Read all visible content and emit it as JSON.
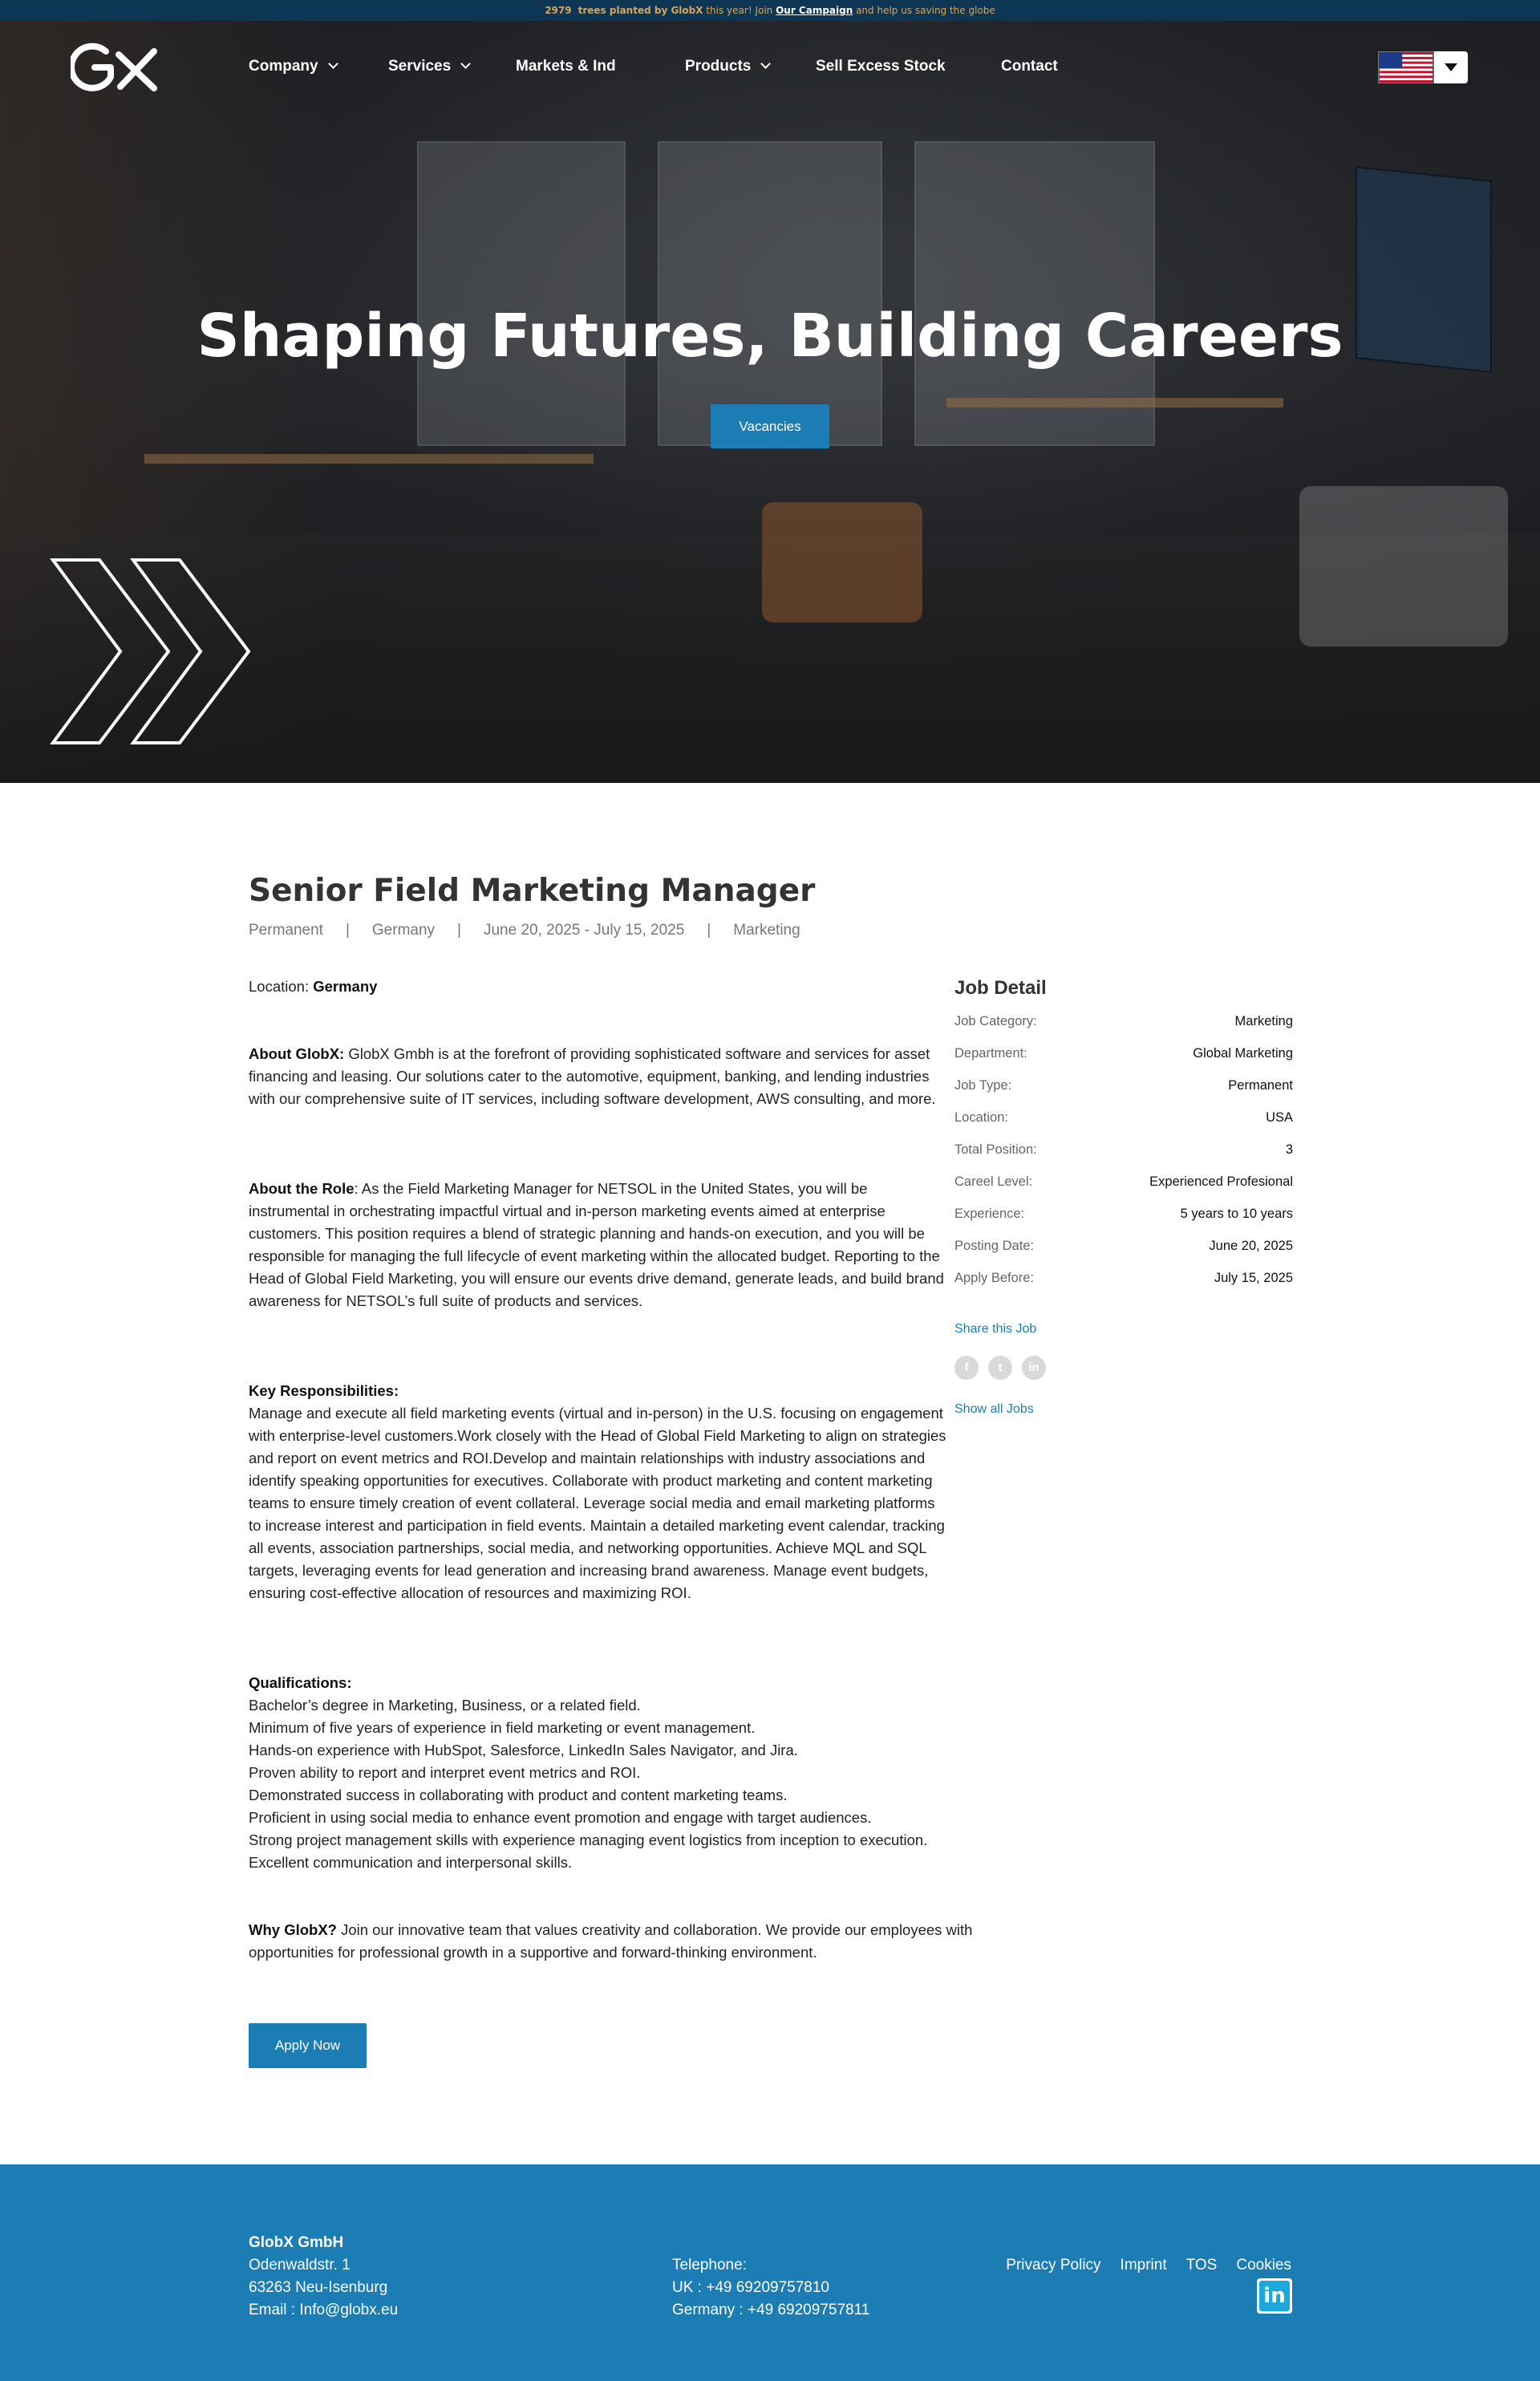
{
  "topbar": {
    "trees_count": "2979",
    "trees_text": "trees planted by GlobX",
    "middle_text": " this year! Join ",
    "campaign_link": "Our Campaign",
    "end_text": " and help us saving the globe"
  },
  "brand": {
    "logo_text": "GX"
  },
  "nav": {
    "items": [
      {
        "label": "Company",
        "has_dropdown": true
      },
      {
        "label": "Services",
        "has_dropdown": true
      },
      {
        "label": "Markets & Ind",
        "has_dropdown": false
      },
      {
        "label": "Products",
        "has_dropdown": true
      },
      {
        "label": "Sell Excess Stock",
        "has_dropdown": false
      },
      {
        "label": "Contact",
        "has_dropdown": false
      }
    ],
    "language_icon": "us-flag-icon"
  },
  "hero": {
    "title": "Shaping Futures, Building Careers",
    "cta": "Vacancies"
  },
  "job": {
    "title": "Senior Field Marketing Manager",
    "meta": [
      "Permanent",
      "Germany",
      "June 20, 2025 - July 15, 2025",
      "Marketing"
    ],
    "meta_separator": "|",
    "location_label": "Location: ",
    "location_value": "Germany",
    "about_globx_label": "About GlobX:",
    "about_globx_text": " GlobX Gmbh is at the forefront of providing sophisticated software and services for asset financing and leasing. Our solutions cater to the automotive, equipment, banking, and lending industries with our comprehensive suite of IT services, including software development, AWS consulting, and more.",
    "about_role_label": "About the Role",
    "about_role_text": ": As the Field Marketing Manager for NETSOL in the United States, you will be instrumental in orchestrating impactful virtual and in-person marketing events aimed at enterprise customers. This position requires a blend of strategic planning and hands-on execution, and you will be responsible for managing the full lifecycle of event marketing within the allocated budget. Reporting to the Head of Global Field Marketing, you will ensure our events drive demand, generate leads, and build brand awareness for NETSOL’s full suite of products and services.",
    "responsibilities_label": "Key Responsibilities:",
    "responsibilities_text": "Manage and execute all field marketing events (virtual and in-person) in the U.S. focusing on engagement with enterprise-level customers.Work closely with the Head of Global Field Marketing to align on strategies and report on event metrics and ROI.Develop and maintain relationships with industry associations and identify speaking opportunities for executives. Collaborate with product marketing and content marketing teams to ensure timely creation of event collateral. Leverage social media and email marketing platforms to increase interest and participation in field events. Maintain a detailed marketing event calendar, tracking all events, association partnerships, social media, and networking opportunities. Achieve MQL and SQL targets, leveraging events for lead generation and increasing brand awareness. Manage event budgets, ensuring cost-effective allocation of resources and maximizing ROI.",
    "qualifications_label": "Qualifications:",
    "qualifications": [
      "Bachelor’s degree in Marketing, Business, or a related field.",
      "Minimum of five years of experience in field marketing or event management.",
      "Hands-on experience with HubSpot, Salesforce, LinkedIn Sales Navigator, and Jira.",
      "Proven ability to report and interpret event metrics and ROI.",
      "Demonstrated success in collaborating with product and content marketing teams.",
      "Proficient in using social media to enhance event promotion and engage with target audiences.",
      "Strong project management skills with experience managing event logistics from inception to execution.",
      "Excellent communication and interpersonal skills."
    ],
    "why_label": "Why GlobX?",
    "why_text": " Join our innovative team that values creativity and collaboration. We provide our employees with opportunities for professional growth in a supportive and forward-thinking environment.",
    "apply_label": "Apply Now"
  },
  "sidebar": {
    "title": "Job Detail",
    "details": [
      {
        "key": "Job Category:",
        "value": "Marketing"
      },
      {
        "key": "Department:",
        "value": "Global Marketing"
      },
      {
        "key": "Job Type:",
        "value": "Permanent"
      },
      {
        "key": "Location:",
        "value": "USA"
      },
      {
        "key": "Total Position:",
        "value": "3"
      },
      {
        "key": "Careel Level:",
        "value": "Experienced Profesional"
      },
      {
        "key": "Experience:",
        "value": "5 years to 10 years"
      },
      {
        "key": "Posting Date:",
        "value": "June 20, 2025"
      },
      {
        "key": "Apply Before:",
        "value": "July 15, 2025"
      }
    ],
    "share_title": "Share this Job",
    "share_icons": [
      "facebook-icon",
      "twitter-icon",
      "linkedin-icon"
    ],
    "show_all": "Show all Jobs"
  },
  "footer": {
    "company": "GlobX GmbH",
    "street": "Odenwaldstr. 1",
    "city": "63263 Neu-Isenburg",
    "email": "Email : Info@globx.eu",
    "telephone_label": "Telephone:",
    "phone_uk": "UK : +49 69209757810",
    "phone_de": "Germany : +49 69209757811",
    "links": [
      "Privacy Policy",
      "Imprint",
      "TOS",
      "Cookies"
    ],
    "social_icon": "linkedin-icon"
  },
  "colors": {
    "primary": "#1b7db3",
    "topbar_bg": "#0d3655",
    "topbar_text": "#d8a45a"
  }
}
